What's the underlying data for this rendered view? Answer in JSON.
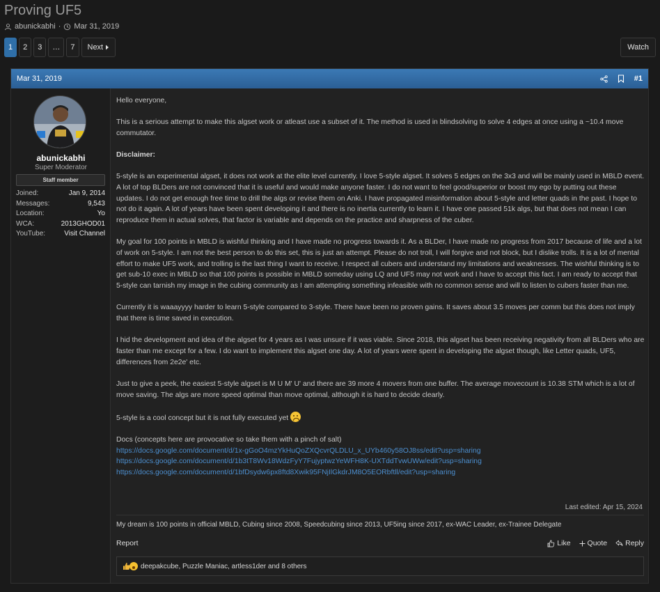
{
  "thread": {
    "title": "Proving UF5",
    "author": "abunickabhi",
    "date": "Mar 31, 2019",
    "separator": "·"
  },
  "pagination": {
    "pages": [
      "1",
      "2",
      "3",
      "…",
      "7"
    ],
    "active": "1",
    "next_label": "Next"
  },
  "watch_label": "Watch",
  "post": {
    "date": "Mar 31, 2019",
    "number": "#1",
    "user": {
      "name": "abunickabhi",
      "title": "Super Moderator",
      "badge": "Staff member",
      "stats": [
        {
          "k": "Joined:",
          "v": "Jan 9, 2014"
        },
        {
          "k": "Messages:",
          "v": "9,543"
        },
        {
          "k": "Location:",
          "v": "Yo"
        },
        {
          "k": "WCA:",
          "v": "2013GHOD01"
        },
        {
          "k": "YouTube:",
          "v": "Visit Channel"
        }
      ]
    },
    "body": {
      "greeting": "Hello everyone,",
      "p1": "This is a serious attempt to make this algset work or atleast use a subset of it. The method is used in blindsolving to solve 4 edges at once using a ~10.4 move commutator.",
      "disclaimer": "Disclaimer:",
      "p2": "5-style is an experimental algset, it does not work at the elite level currently. I love 5-style algset. It solves 5 edges on the 3x3 and will be mainly used in MBLD event. A lot of top BLDers are not convinced that it is useful and would make anyone faster. I do not want to feel good/superior or boost my ego by putting out these updates. I do not get enough free time to drill the algs or revise them on Anki. I have propagated misinformation about 5-style and letter quads in the past. I hope to not do it again. A lot of years have been spent developing it and there is no inertia currently to learn it. I have one passed 51k algs, but that does not mean I can reproduce them in actual solves, that factor is variable and depends on the practice and sharpness of the cuber.",
      "p3": "My goal for 100 points in MBLD is wishful thinking and I have made no progress towards it. As a BLDer, I have made no progress from 2017 because of life and a lot of work on 5-style. I am not the best person to do this set, this is just an attempt. Please do not troll, I will forgive and not block, but I dislike trolls. It is a lot of mental effort to make UF5 work, and trolling is the last thing I want to receive. I respect all cubers and understand my limitations and weaknesses. The wishful thinking is to get sub-10 exec in MBLD so that 100 points is possible in MBLD someday using LQ and UF5 may not work and I have to accept this fact. I am ready to accept that 5-style can tarnish my image in the cubing community as I am attempting something infeasible with no common sense and will to listen to cubers faster than me.",
      "p4": "Currently it is waaayyyy harder to learn 5-style compared to 3-style. There have been no proven gains. It saves about 3.5 moves per comm but this does not imply that there is time saved in execution.",
      "p5": "I hid the development and idea of the algset for 4 years as I was unsure if it was viable. Since 2018, this algset has been receiving negativity from all BLDers who are faster than me except for a few. I do want to implement this algset one day. A lot of years were spent in developing the algset though, like Letter quads, UF5, differences from 2e2e' etc.",
      "p6": "Just to give a peek, the easiest 5-style algset is M U M' U' and there are 39 more 4 movers from one buffer. The average movecount is 10.38 STM which is a lot of move saving. The algs are more speed optimal than move optimal, although it is hard to decide clearly.",
      "p7": "5-style is a cool concept but it is not fully executed yet",
      "docs": "Docs (concepts here are provocative so take them with a pinch of salt)",
      "links": [
        "https://docs.google.com/document/d/1x-gGoO4mzYkHuQoZXQcvrQLDLU_x_UYb460y58OJ8ss/edit?usp=sharing",
        "https://docs.google.com/document/d/1b3tT8Wv18WdzFyY7FujyptwzYeWFH8K-UXTddTvwUWw/edit?usp=sharing",
        "https://docs.google.com/document/d/1bfDsydw6px8ftd8Xwik95FNjIlGkdrJM8O5EORbftll/edit?usp=sharing"
      ]
    },
    "last_edited": "Last edited: Apr 15, 2024",
    "signature": "My dream is 100 points in official MBLD, Cubing since 2008, Speedcubing since 2013, UF5ing since 2017, ex-WAC Leader, ex-Trainee Delegate",
    "actions": {
      "report": "Report",
      "like": "Like",
      "quote": "Quote",
      "reply": "Reply"
    },
    "reactions_text": "deepakcube, Puzzle Maniac, artless1der and 8 others"
  },
  "colors": {
    "accent": "#2f6fa8",
    "link": "#4c8fd0",
    "background": "#1a1a1a"
  }
}
